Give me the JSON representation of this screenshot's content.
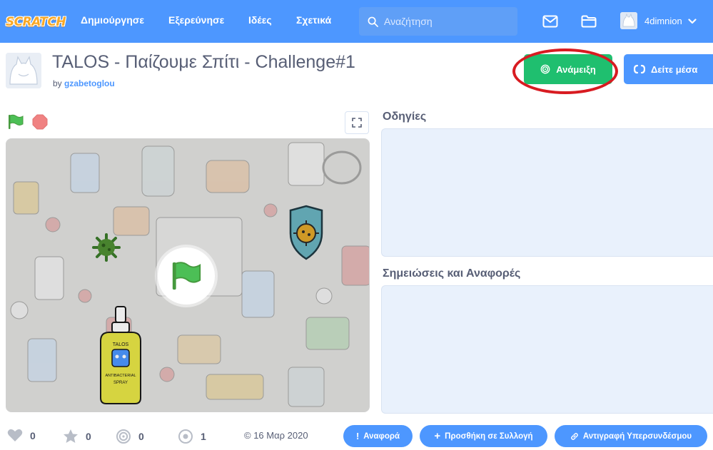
{
  "nav": {
    "logo": "SCRATCH",
    "links": [
      "Δημιούργησε",
      "Εξερεύνησε",
      "Ιδέες",
      "Σχετικά"
    ],
    "search_placeholder": "Αναζήτηση",
    "username": "4dimnion"
  },
  "project": {
    "title": "TALOS - Παίζουμε Σπίτι - Challenge#1",
    "by_prefix": "by",
    "author": "gzabetoglou",
    "remix_label": "Ανάμειξη",
    "see_inside_label": "Δείτε μέσα"
  },
  "panels": {
    "instructions_label": "Οδηγίες",
    "notes_label": "Σημειώσεις και Αναφορές"
  },
  "stats": {
    "loves": "0",
    "favorites": "0",
    "remixes": "0",
    "views": "1",
    "date": "16 Μαρ 2020"
  },
  "actions": {
    "report": "Αναφορά",
    "add_to_studio": "Προσθήκη σε Συλλογή",
    "copy_link": "Αντιγραφή Υπερσυνδέσμου"
  },
  "stage_sprites": {
    "bottle_label_1": "TALOS",
    "bottle_label_2": "ANTIBACTERIAL",
    "bottle_label_3": "SPRAY"
  },
  "colors": {
    "nav_blue": "#4d97ff",
    "remix_green": "#1fbf6f",
    "highlight_red": "#d81b21"
  }
}
